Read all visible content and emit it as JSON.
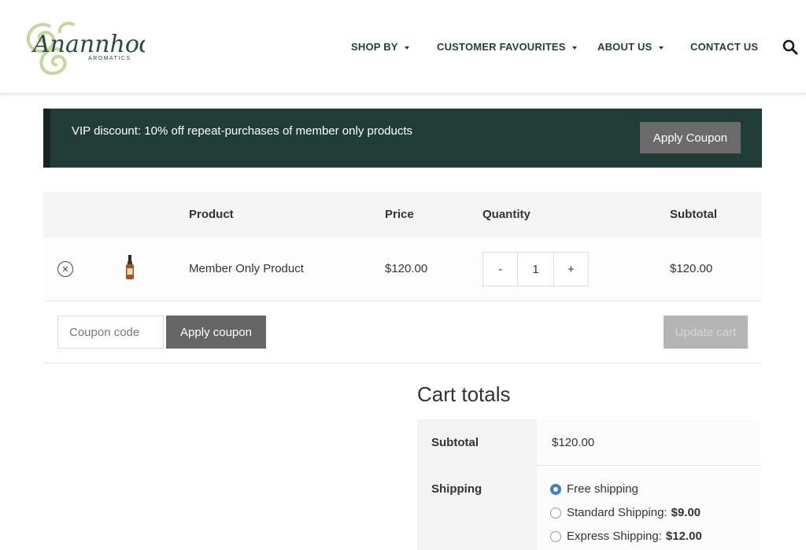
{
  "header": {
    "brand": "Anannhod",
    "brand_sub": "AROMATICS",
    "nav": [
      {
        "label": "SHOP BY",
        "dropdown": true
      },
      {
        "label": "CUSTOMER FAVOURITES",
        "dropdown": true
      },
      {
        "label": "ABOUT US",
        "dropdown": true
      },
      {
        "label": "CONTACT US",
        "dropdown": false
      }
    ],
    "search_icon": "search-icon"
  },
  "notice": {
    "text": "VIP discount: 10% off repeat-purchases of member only products",
    "button": "Apply Coupon"
  },
  "cart": {
    "columns": [
      "Product",
      "Price",
      "Quantity",
      "Subtotal"
    ],
    "items": [
      {
        "name": "Member Only Product",
        "price": "$120.00",
        "quantity": "1",
        "subtotal": "$120.00"
      }
    ],
    "qty_minus": "-",
    "qty_plus": "+",
    "coupon_placeholder": "Coupon code",
    "apply_coupon": "Apply coupon",
    "update_cart": "Update cart"
  },
  "totals": {
    "title": "Cart totals",
    "subtotal_label": "Subtotal",
    "subtotal_value": "$120.00",
    "shipping_label": "Shipping",
    "shipping_options": [
      {
        "label": "Free shipping",
        "price": "",
        "selected": true
      },
      {
        "label": "Standard Shipping:",
        "price": "$9.00",
        "selected": false
      },
      {
        "label": "Express Shipping:",
        "price": "$12.00",
        "selected": false
      }
    ]
  },
  "colors": {
    "brand_dark": "#223d38",
    "nav_text": "#1f3d3a",
    "radio_selected": "#3b7ddd",
    "button_gray": "#666666"
  }
}
